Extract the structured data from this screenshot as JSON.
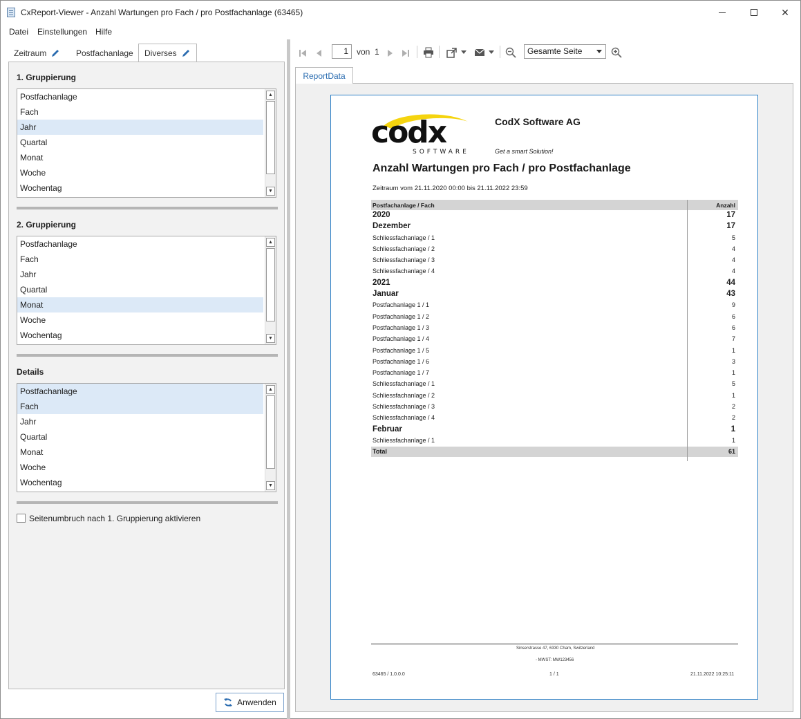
{
  "window": {
    "title": "CxReport-Viewer - Anzahl Wartungen pro Fach / pro Postfachanlage (63465)",
    "minimize": "—",
    "maximize": "☐",
    "close": "✕"
  },
  "menu": [
    "Datei",
    "Einstellungen",
    "Hilfe"
  ],
  "tabs": [
    "Zeitraum",
    "Postfachanlage",
    "Diverses"
  ],
  "group1": {
    "title": "1. Gruppierung",
    "items": [
      "Postfachanlage",
      "Fach",
      "Jahr",
      "Quartal",
      "Monat",
      "Woche",
      "Wochentag"
    ],
    "selected": [
      "Jahr"
    ]
  },
  "group2": {
    "title": "2. Gruppierung",
    "items": [
      "Postfachanlage",
      "Fach",
      "Jahr",
      "Quartal",
      "Monat",
      "Woche",
      "Wochentag"
    ],
    "selected": [
      "Monat"
    ]
  },
  "details": {
    "title": "Details",
    "items": [
      "Postfachanlage",
      "Fach",
      "Jahr",
      "Quartal",
      "Monat",
      "Woche",
      "Wochentag"
    ],
    "selected": [
      "Postfachanlage",
      "Fach"
    ]
  },
  "pagebreak_label": "Seitenumbruch nach 1. Gruppierung aktivieren",
  "pagebreak_checked": false,
  "apply_label": "Anwenden",
  "toolbar": {
    "page": "1",
    "of_label": "von",
    "total_pages": "1",
    "zoom": "Gesamte Seite"
  },
  "report_tab": "ReportData",
  "report": {
    "logo_text": "codx",
    "logo_sub": "SOFTWARE",
    "company": "CodX Software AG",
    "slogan": "Get a smart Solution!",
    "title": "Anzahl Wartungen pro Fach / pro Postfachanlage",
    "period": "Zeitraum vom 21.11.2020 00:00 bis 21.11.2022 23:59",
    "header": [
      "Postfachanlage / Fach",
      "Anzahl"
    ],
    "rows": [
      {
        "label": "2020",
        "value": "17",
        "style": "big"
      },
      {
        "label": "Dezember",
        "value": "17",
        "style": "big"
      },
      {
        "label": "Schliessfachanlage / 1",
        "value": "5",
        "style": "normal"
      },
      {
        "label": "Schliessfachanlage / 2",
        "value": "4",
        "style": "normal"
      },
      {
        "label": "Schliessfachanlage / 3",
        "value": "4",
        "style": "normal"
      },
      {
        "label": "Schliessfachanlage / 4",
        "value": "4",
        "style": "normal"
      },
      {
        "label": "2021",
        "value": "44",
        "style": "big"
      },
      {
        "label": "Januar",
        "value": "43",
        "style": "big"
      },
      {
        "label": "Postfachanlage 1 / 1",
        "value": "9",
        "style": "normal"
      },
      {
        "label": "Postfachanlage 1 / 2",
        "value": "6",
        "style": "normal"
      },
      {
        "label": "Postfachanlage 1 / 3",
        "value": "6",
        "style": "normal"
      },
      {
        "label": "Postfachanlage 1 / 4",
        "value": "7",
        "style": "normal"
      },
      {
        "label": "Postfachanlage 1 / 5",
        "value": "1",
        "style": "normal"
      },
      {
        "label": "Postfachanlage 1 / 6",
        "value": "3",
        "style": "normal"
      },
      {
        "label": "Postfachanlage 1 / 7",
        "value": "1",
        "style": "normal"
      },
      {
        "label": "Schliessfachanlage / 1",
        "value": "5",
        "style": "normal"
      },
      {
        "label": "Schliessfachanlage / 2",
        "value": "1",
        "style": "normal"
      },
      {
        "label": "Schliessfachanlage / 3",
        "value": "2",
        "style": "normal"
      },
      {
        "label": "Schliessfachanlage / 4",
        "value": "2",
        "style": "normal"
      },
      {
        "label": "Februar",
        "value": "1",
        "style": "big"
      },
      {
        "label": "Schliessfachanlage / 1",
        "value": "1",
        "style": "normal"
      }
    ],
    "total": [
      "Total",
      "61"
    ],
    "footer_address": "Sinserstrasse 47, 6330 Cham,  Switzerland",
    "footer_vat": "- MWST: MW123456",
    "footer_left": "63465 / 1.0.0.0",
    "footer_center": "1 / 1",
    "footer_right": "21.11.2022 10:25:11"
  },
  "colors": {
    "accent": "#2b7fc6",
    "selection": "#dce9f7",
    "logo_yellow": "#f5d40f"
  }
}
